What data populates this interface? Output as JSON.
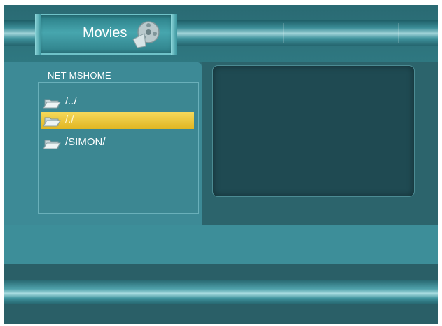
{
  "header": {
    "title": "Movies",
    "icon": "film-reel-icon"
  },
  "browser": {
    "path": "NET  MSHOME",
    "selected_index": 1,
    "items": [
      {
        "label": "/../",
        "icon": "folder-icon"
      },
      {
        "label": "/./",
        "icon": "folder-icon"
      },
      {
        "label": "/SIMON/",
        "icon": "folder-icon"
      }
    ]
  },
  "colors": {
    "selection": "#e8c23a",
    "panel": "#3d8a96",
    "preview": "#1f4a52"
  }
}
